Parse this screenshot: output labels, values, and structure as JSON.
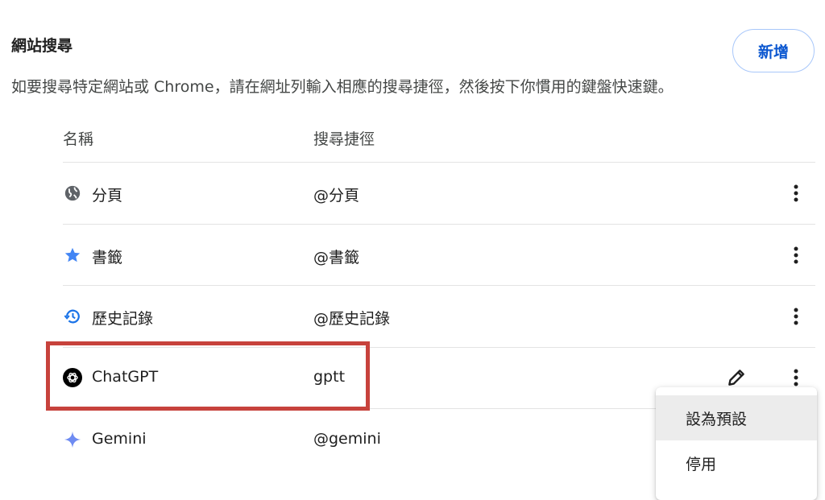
{
  "site_search": {
    "title": "網站搜尋",
    "description": "如要搜尋特定網站或 Chrome，請在網址列輸入相應的搜尋捷徑，然後按下你慣用的鍵盤快速鍵。",
    "add_button": "新增"
  },
  "table": {
    "headers": {
      "name": "名稱",
      "shortcut": "搜尋捷徑"
    },
    "rows": [
      {
        "name": "分頁",
        "shortcut": "@分頁",
        "icon": "globe-icon"
      },
      {
        "name": "書籤",
        "shortcut": "@書籤",
        "icon": "star-icon"
      },
      {
        "name": "歷史記錄",
        "shortcut": "@歷史記錄",
        "icon": "history-icon"
      },
      {
        "name": "ChatGPT",
        "shortcut": "gptt",
        "icon": "chatgpt-logo-icon"
      },
      {
        "name": "Gemini",
        "shortcut": "@gemini",
        "icon": "gemini-sparkle-icon"
      }
    ]
  },
  "context_menu": {
    "items": [
      {
        "label": "設為預設"
      },
      {
        "label": "停用"
      }
    ]
  },
  "colors": {
    "accent": "#0b57d0",
    "highlight_border": "#c7423c",
    "star": "#4285f4",
    "history": "#1a73e8",
    "gemini": "#6e8bf2"
  }
}
